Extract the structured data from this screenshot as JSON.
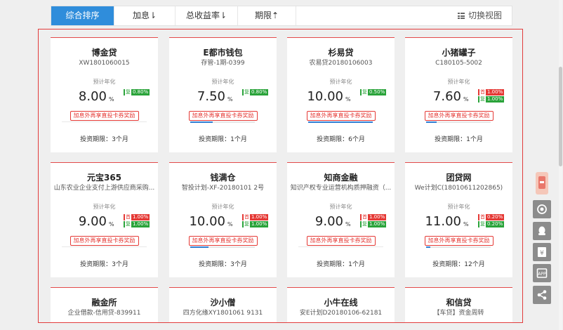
{
  "sort_tabs": [
    {
      "label": "综合排序",
      "active": true
    },
    {
      "label": "加息⇂",
      "active": false
    },
    {
      "label": "总收益率⇂",
      "active": false
    },
    {
      "label": "期限⇡",
      "active": false
    }
  ],
  "view_toggle": {
    "label": "切换视图",
    "icon": "grid-list-icon"
  },
  "common": {
    "rate_label": "预计年化",
    "percent_sign": "%",
    "reward_label": "加息外再享直投卡券奖励"
  },
  "products": [
    {
      "name": "博金贷",
      "code": "XW1801060015",
      "rate": "8.00",
      "badges": [
        {
          "tag": "复",
          "value": "0.80%",
          "color": "green"
        }
      ],
      "progress": 0.0,
      "term": "投资期限：3个月"
    },
    {
      "name": "E都市钱包",
      "code": "存管-1期-0399",
      "rate": "7.50",
      "badges": [
        {
          "tag": "复",
          "value": "0.80%",
          "color": "green"
        }
      ],
      "progress": 0.35,
      "term": "投资期限：1个月"
    },
    {
      "name": "杉易贷",
      "code": "农易贷20180106003",
      "rate": "10.00",
      "badges": [
        {
          "tag": "复",
          "value": "0.50%",
          "color": "green"
        }
      ],
      "progress": 1.0,
      "term": "投资期限：6个月"
    },
    {
      "name": "小猪罐子",
      "code": "C180105-5002",
      "rate": "7.60",
      "badges": [
        {
          "tag": "首",
          "value": "1.00%",
          "color": "red"
        },
        {
          "tag": "复",
          "value": "1.00%",
          "color": "green"
        }
      ],
      "progress": 0.16,
      "term": "投资期限：1个月"
    },
    {
      "name": "元宝365",
      "code": "山东农业企业支付上游供应商采购...",
      "rate": "9.00",
      "badges": [
        {
          "tag": "首",
          "value": "1.00%",
          "color": "red"
        },
        {
          "tag": "复",
          "value": "1.00%",
          "color": "green"
        }
      ],
      "progress": 0.0,
      "term": "投资期限：3个月"
    },
    {
      "name": "钱满仓",
      "code": "智投计划-XF-20180101 2号",
      "rate": "10.00",
      "badges": [
        {
          "tag": "首",
          "value": "1.00%",
          "color": "red"
        },
        {
          "tag": "复",
          "value": "1.00%",
          "color": "green"
        }
      ],
      "progress": 0.28,
      "term": "投资期限：3个月"
    },
    {
      "name": "知商金融",
      "code": "知识产权专业运营机构质押融资（...",
      "rate": "9.00",
      "badges": [
        {
          "tag": "首",
          "value": "1.00%",
          "color": "red"
        },
        {
          "tag": "复",
          "value": "1.00%",
          "color": "green"
        }
      ],
      "progress": 0.0,
      "term": "投资期限：1个月"
    },
    {
      "name": "团贷网",
      "code": "We计划C(18010611202865)",
      "rate": "11.00",
      "badges": [
        {
          "tag": "首",
          "value": "0.20%",
          "color": "red"
        },
        {
          "tag": "复",
          "value": "0.20%",
          "color": "green"
        }
      ],
      "progress": 0.06,
      "term": "投资期限：12个月"
    },
    {
      "name": "融金所",
      "code": "企业借款-信用贷-839911"
    },
    {
      "name": "沙小僧",
      "code": "四方化缘XY1801061 9131"
    },
    {
      "name": "小牛在线",
      "code": "安E计划D20180106-62181"
    },
    {
      "name": "和信贷",
      "code": "【车贷】资金周转"
    }
  ],
  "side_tools": [
    "customer-service-icon",
    "qq-icon",
    "yen-icon",
    "app-icon",
    "share-icon"
  ]
}
